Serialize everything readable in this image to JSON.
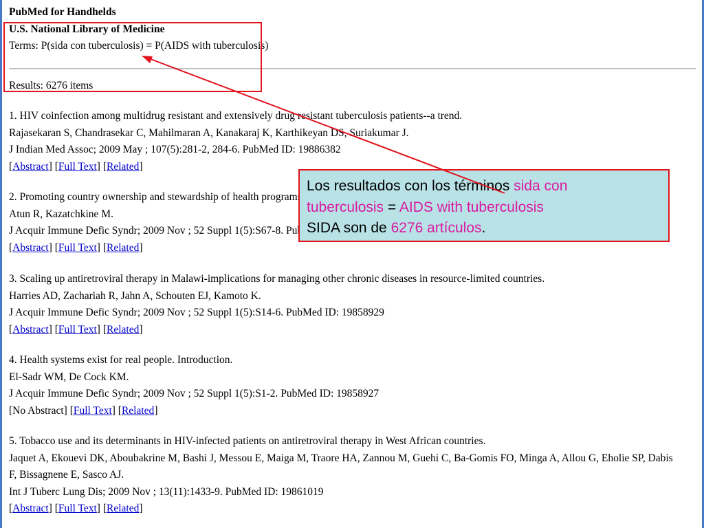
{
  "header": {
    "app_title": "PubMed for Handhelds",
    "org": "U.S. National Library of Medicine",
    "terms": "Terms: P(sida con tuberculosis) = P(AIDS with tuberculosis)",
    "results": "Results: 6276 items"
  },
  "records": [
    {
      "title": "1. HIV coinfection among multidrug resistant and extensively drug resistant tuberculosis patients--a trend.",
      "authors": "Rajasekaran S, Chandrasekar C, Mahilmaran A, Kanakaraj K, Karthikeyan DS, Suriakumar J.",
      "citation": "J Indian Med Assoc; 2009 May ; 107(5):281-2, 284-6. PubMed ID: 19886382",
      "links": {
        "abstract": "Abstract",
        "full_text": "Full Text",
        "related": "Related"
      }
    },
    {
      "title": "2. Promoting country ownership and stewardship of health programs: T",
      "authors": "Atun R, Kazatchkine M.",
      "citation": "J Acquir Immune Defic Syndr; 2009 Nov ; 52 Suppl 1(5):S67-8. PubM",
      "links": {
        "abstract": "Abstract",
        "full_text": "Full Text",
        "related": "Related"
      }
    },
    {
      "title": "3. Scaling up antiretroviral therapy in Malawi-implications for managing other chronic diseases in resource-limited countries.",
      "authors": "Harries AD, Zachariah R, Jahn A, Schouten EJ, Kamoto K.",
      "citation": "J Acquir Immune Defic Syndr; 2009 Nov ; 52 Suppl 1(5):S14-6. PubMed ID: 19858929",
      "links": {
        "abstract": "Abstract",
        "full_text": "Full Text",
        "related": "Related"
      }
    },
    {
      "title": "4. Health systems exist for real people. Introduction.",
      "authors": "El-Sadr WM, De Cock KM.",
      "citation": "J Acquir Immune Defic Syndr; 2009 Nov ; 52 Suppl 1(5):S1-2. PubMed ID: 19858927",
      "links": {
        "no_abstract": "No Abstract",
        "full_text": "Full Text",
        "related": "Related"
      }
    },
    {
      "title": "5. Tobacco use and its determinants in HIV-infected patients on antiretroviral therapy in West African countries.",
      "authors": "Jaquet A, Ekouevi DK, Aboubakrine M, Bashi J, Messou E, Maiga M, Traore HA, Zannou M, Guehi C, Ba-Gomis FO, Minga A, Allou G, Eholie SP, Dabis F, Bissagnene E, Sasco AJ.",
      "citation": "Int J Tuberc Lung Dis; 2009 Nov ; 13(11):1433-9. PubMed ID: 19861019",
      "links": {
        "abstract": "Abstract",
        "full_text": "Full Text",
        "related": "Related"
      }
    }
  ],
  "callout": {
    "line1_a": "Los resultados con los términos ",
    "line1_b": "sida con",
    "line2_a": "tuberculosis",
    "line2_b": " = ",
    "line2_c": "AIDS with tuberculosis",
    "line3_a": "SIDA son de ",
    "line3_b": "6276 artículos",
    "line3_c": "."
  },
  "colors": {
    "annotation_red": "#e2141e",
    "callout_bg": "#b9e2e6",
    "highlight": "#d81aa0",
    "link": "#0000cc"
  }
}
